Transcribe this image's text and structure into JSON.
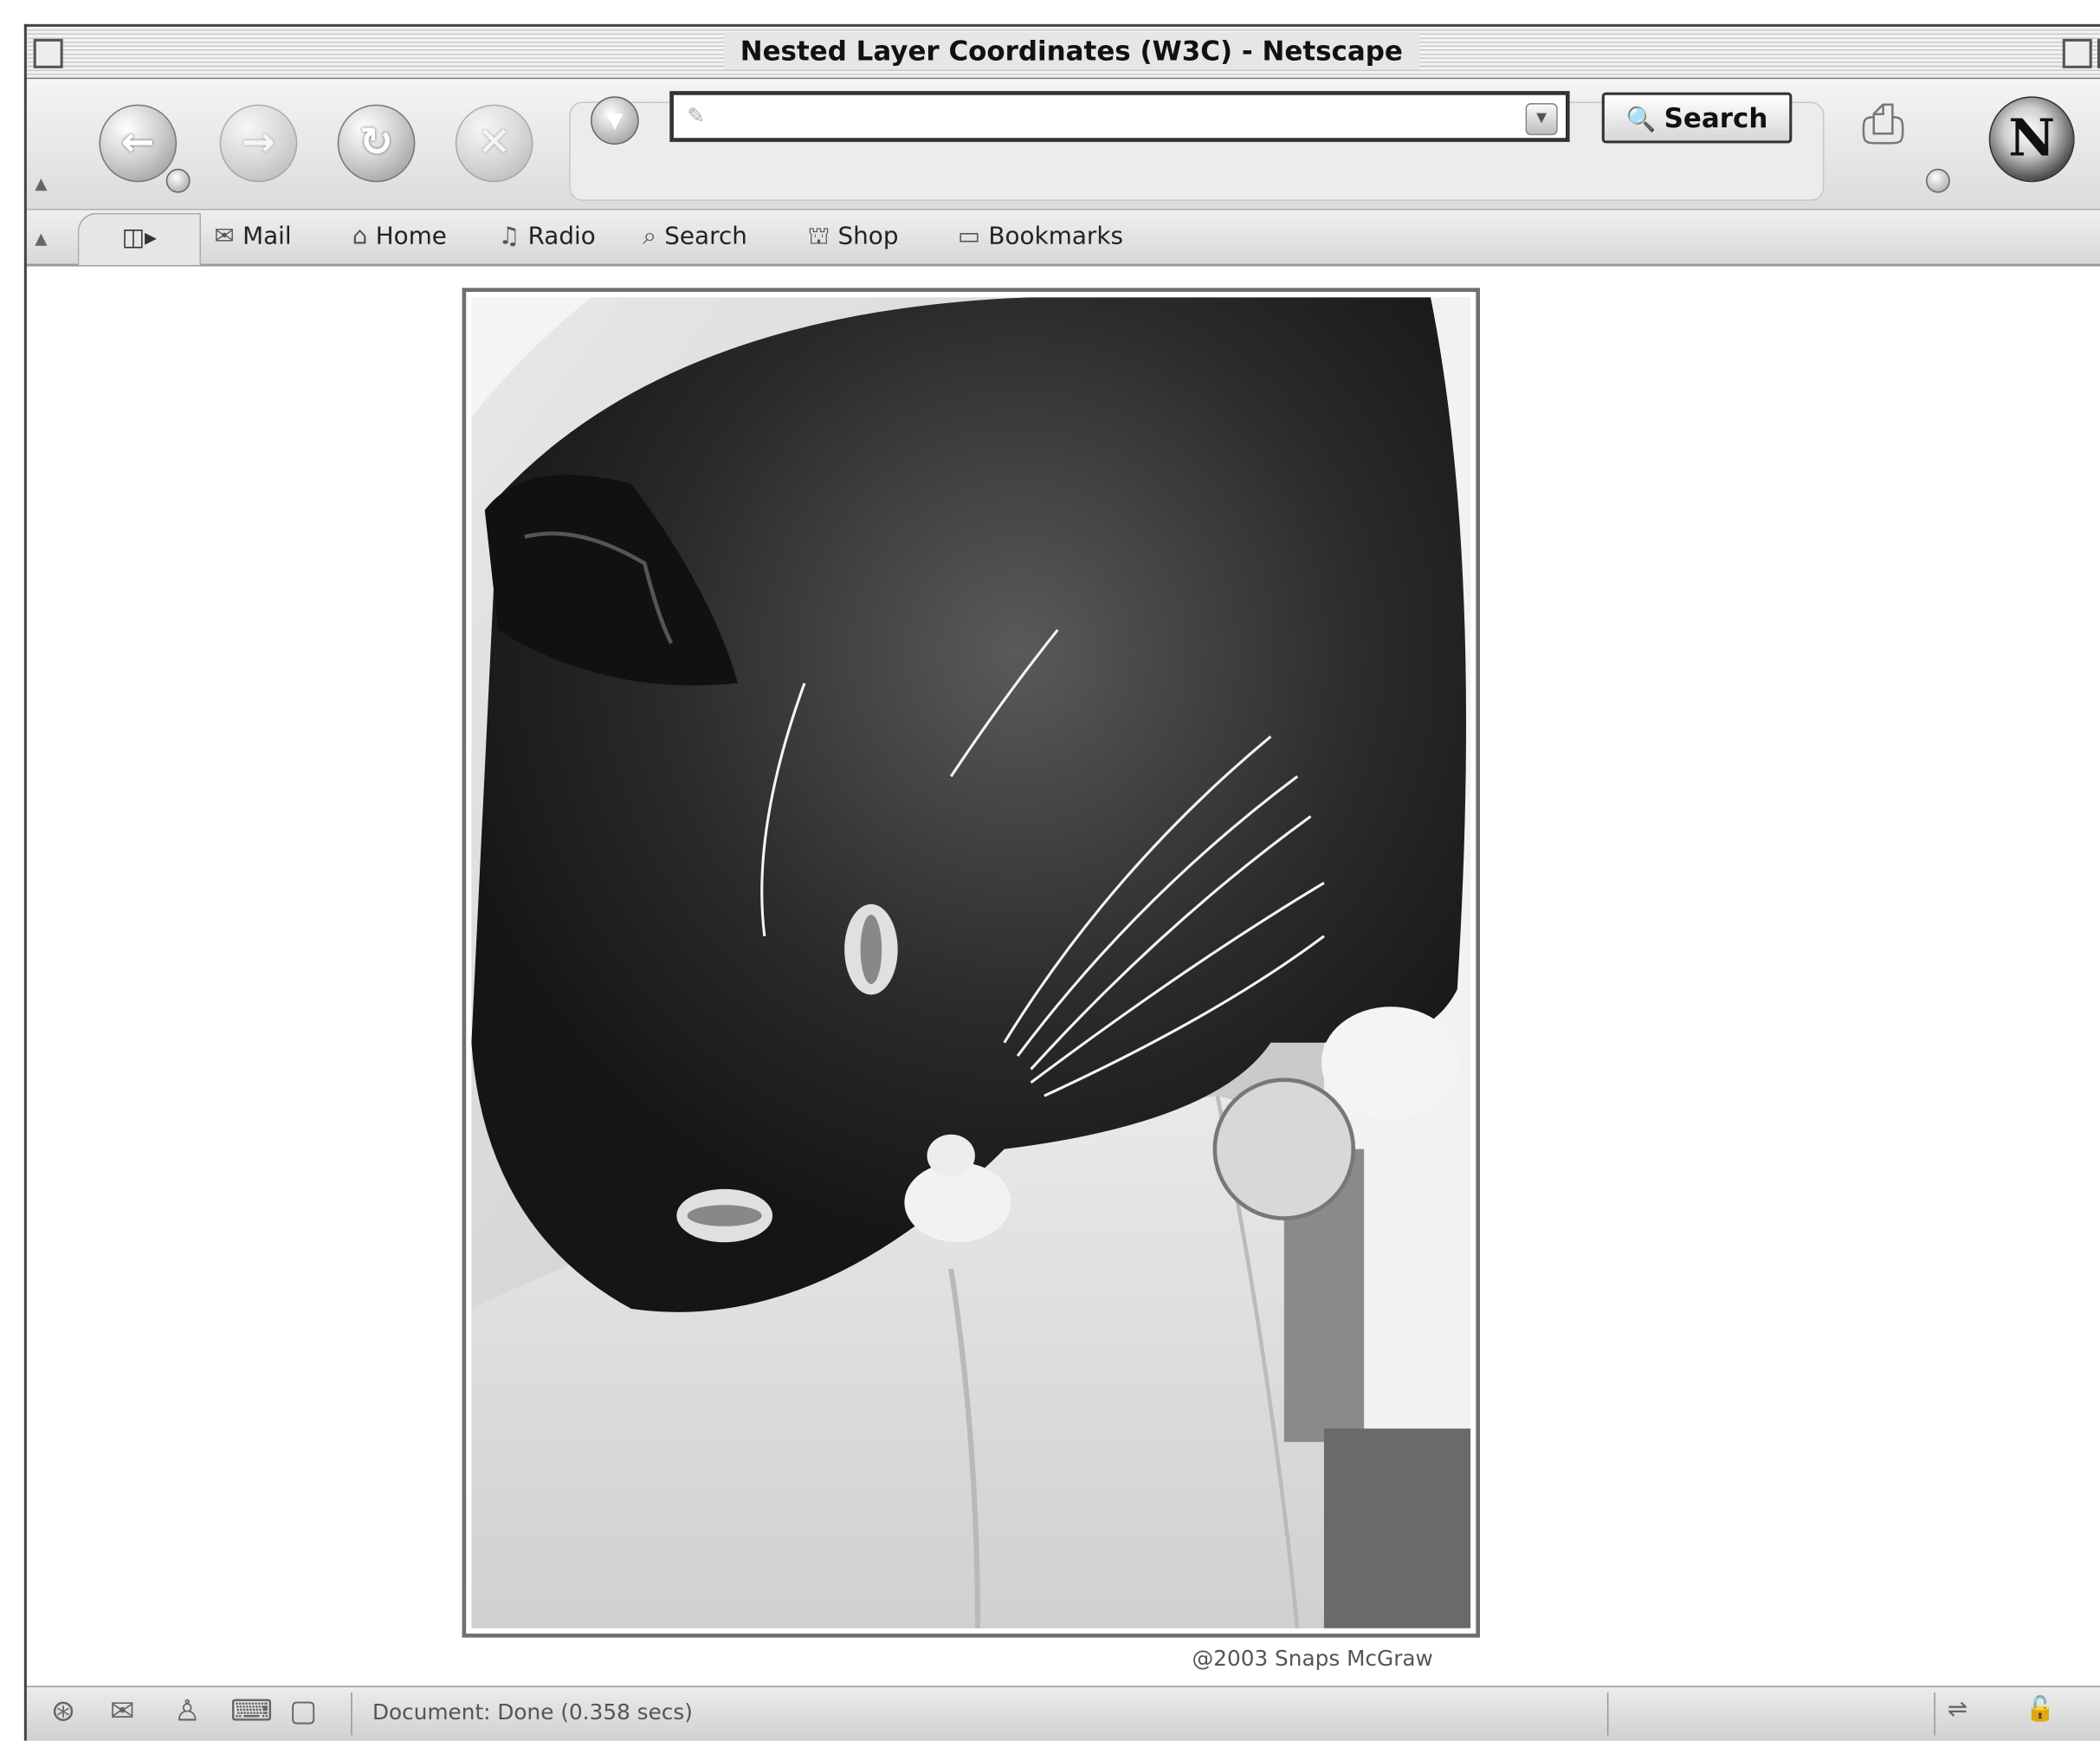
{
  "window": {
    "title": "Nested Layer Coordinates (W3C) - Netscape"
  },
  "nav_toolbar": {
    "back_glyph": "←",
    "forward_glyph": "→",
    "reload_glyph": "↻",
    "stop_glyph": "✕",
    "url_value": "",
    "search_label": "Search"
  },
  "personal_toolbar": {
    "items": [
      {
        "label": "Mail",
        "icon": "mail-icon"
      },
      {
        "label": "Home",
        "icon": "home-icon"
      },
      {
        "label": "Radio",
        "icon": "radio-icon"
      },
      {
        "label": "Search",
        "icon": "search-icon"
      },
      {
        "label": "Shop",
        "icon": "shop-icon"
      },
      {
        "label": "Bookmarks",
        "icon": "bookmarks-icon"
      }
    ]
  },
  "content": {
    "photo_caption": "@2003 Snaps McGraw"
  },
  "statusbar": {
    "text": "Document: Done (0.358 secs)"
  }
}
